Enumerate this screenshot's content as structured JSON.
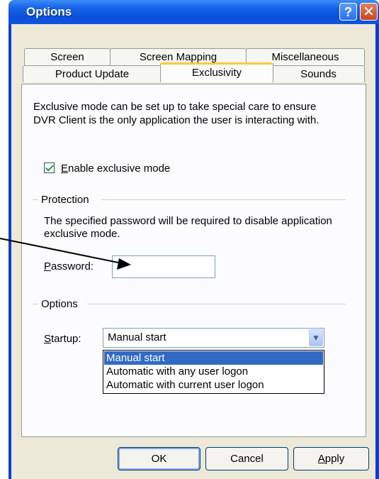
{
  "window": {
    "title": "Options"
  },
  "tabs_row1": [
    "Screen",
    "Screen Mapping",
    "Miscellaneous"
  ],
  "tabs_row2": [
    "Product Update",
    "Exclusivity",
    "Sounds"
  ],
  "active_tab": "Exclusivity",
  "description": {
    "line1": "Exclusive mode can be set up to take special care to ensure",
    "line2": "DVR Client is the only application the user is interacting with."
  },
  "enable_checkbox": {
    "label_first": "E",
    "label_rest": "nable exclusive mode",
    "checked": true
  },
  "protection": {
    "group_label": "Protection",
    "desc_line1": "The specified password will be required to disable application",
    "desc_line2": "exclusive mode.",
    "password_label_first": "P",
    "password_label_rest": "assword:",
    "password_value": ""
  },
  "options": {
    "group_label": "Options",
    "startup_label_first": "S",
    "startup_label_rest": "tartup:",
    "startup_value": "Manual start",
    "dropdown_options": [
      "Manual start",
      "Automatic with any user logon",
      "Automatic with current user logon"
    ],
    "selected_option": "Manual start"
  },
  "buttons": {
    "ok": "OK",
    "cancel": "Cancel",
    "apply_first": "A",
    "apply_rest": "pply"
  },
  "colors": {
    "titlebar": "#0a4fd9",
    "selection": "#316ac5",
    "tab_highlight": "#ffc83c"
  }
}
